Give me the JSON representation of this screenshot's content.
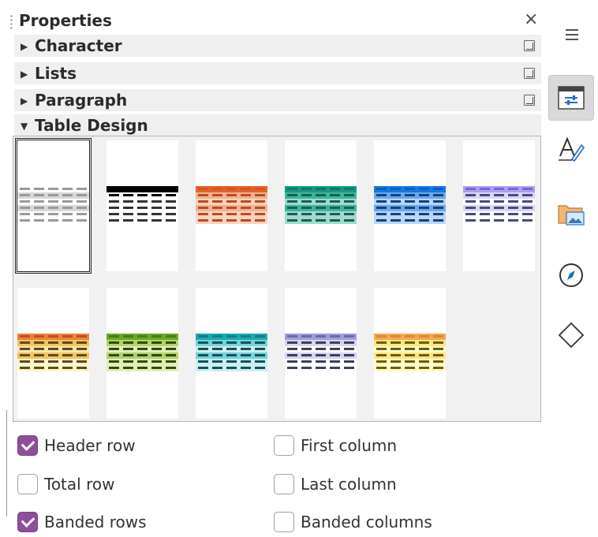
{
  "panel": {
    "title": "Properties",
    "close_glyph": "×"
  },
  "sections": [
    {
      "label": "Character",
      "expanded": false
    },
    {
      "label": "Lists",
      "expanded": false
    },
    {
      "label": "Paragraph",
      "expanded": false
    },
    {
      "label": "Table Design",
      "expanded": true
    }
  ],
  "table_styles": [
    {
      "name": "default",
      "selected": true,
      "colors": [
        "#9a9a9a",
        "#9a9a9a",
        "#9a9a9a",
        "#9a9a9a",
        "#9a9a9a",
        "#9a9a9a"
      ],
      "bg": [
        "#ffffff",
        "#d8d8d8",
        "#ffffff",
        "#d8d8d8",
        "#ffffff",
        "#ffffff"
      ]
    },
    {
      "name": "black",
      "selected": false,
      "colors": [
        "#000000",
        "#000000",
        "#333333",
        "#333333",
        "#333333",
        "#333333"
      ],
      "bg": [
        "#000000",
        "#ffffff",
        "#ffffff",
        "#ffffff",
        "#ffffff",
        "#ffffff"
      ]
    },
    {
      "name": "orange",
      "selected": false,
      "colors": [
        "#d9541e",
        "#b64d24",
        "#b64d24",
        "#b64d24",
        "#b64d24",
        "#b64d24"
      ],
      "bg": [
        "#e8612b",
        "#f6b18f",
        "#fcd3bf",
        "#f6b18f",
        "#fcd3bf",
        "#fcd3bf"
      ]
    },
    {
      "name": "teal",
      "selected": false,
      "colors": [
        "#0f7a66",
        "#1a5e53",
        "#1a5e53",
        "#1a5e53",
        "#1a5e53",
        "#1a5e53"
      ],
      "bg": [
        "#149d85",
        "#3db59c",
        "#9fdacd",
        "#3db59c",
        "#9fdacd",
        "#9fdacd"
      ]
    },
    {
      "name": "blue",
      "selected": false,
      "colors": [
        "#0a5ec2",
        "#1a3f7a",
        "#1a3f7a",
        "#1a3f7a",
        "#1a3f7a",
        "#1a3f7a"
      ],
      "bg": [
        "#137be3",
        "#66a9f0",
        "#b7d7f8",
        "#66a9f0",
        "#b7d7f8",
        "#b7d7f8"
      ]
    },
    {
      "name": "lavender",
      "selected": false,
      "colors": [
        "#7765d8",
        "#4a4880",
        "#4a4880",
        "#4a4880",
        "#4a4880",
        "#4a4880"
      ],
      "bg": [
        "#aba0f0",
        "#d9d4fa",
        "#ffffff",
        "#d9d4fa",
        "#ffffff",
        "#ffffff"
      ]
    },
    {
      "name": "autumn",
      "selected": false,
      "colors": [
        "#c0501e",
        "#5c4a20",
        "#5c4a20",
        "#5c4a20",
        "#5c4a20",
        "#5c4a20"
      ],
      "bg": [
        "#e8833a",
        "#f5c35c",
        "#fae5a8",
        "#f5c35c",
        "#fff6c8",
        "#fff6c8"
      ]
    },
    {
      "name": "green",
      "selected": false,
      "colors": [
        "#4c7a18",
        "#2f4a12",
        "#2f4a12",
        "#2f4a12",
        "#2f4a12",
        "#2f4a12"
      ],
      "bg": [
        "#6aa82a",
        "#b3d36a",
        "#e1efb7",
        "#b3d36a",
        "#e1efb7",
        "#e1efb7"
      ]
    },
    {
      "name": "cyan",
      "selected": false,
      "colors": [
        "#147f86",
        "#1a4f54",
        "#1a4f54",
        "#1a4f54",
        "#1a4f54",
        "#1a4f54"
      ],
      "bg": [
        "#1ba9b3",
        "#72d4da",
        "#c8f0f2",
        "#72d4da",
        "#c8f0f2",
        "#c8f0f2"
      ]
    },
    {
      "name": "slate",
      "selected": false,
      "colors": [
        "#6a6ab0",
        "#3d3d60",
        "#3d3d60",
        "#3d3d60",
        "#3d3d60",
        "#3d3d60"
      ],
      "bg": [
        "#9e9edc",
        "#d5d5f2",
        "#ffffff",
        "#d5d5f2",
        "#ffffff",
        "#ffffff"
      ]
    },
    {
      "name": "yellow",
      "selected": false,
      "colors": [
        "#d98a2a",
        "#6e5a12",
        "#6e5a12",
        "#6e5a12",
        "#6e5a12",
        "#6e5a12"
      ],
      "bg": [
        "#f3a953",
        "#ffe680",
        "#ffffc4",
        "#ffe680",
        "#ffffc4",
        "#ffffc4"
      ]
    }
  ],
  "options": [
    {
      "label": "Header row",
      "checked": true
    },
    {
      "label": "First column",
      "checked": false
    },
    {
      "label": "Total row",
      "checked": false
    },
    {
      "label": "Last column",
      "checked": false
    },
    {
      "label": "Banded rows",
      "checked": true
    },
    {
      "label": "Banded columns",
      "checked": false
    }
  ],
  "sidebar": {
    "items": [
      {
        "name": "properties",
        "icon": "properties-icon",
        "active": true
      },
      {
        "name": "styles",
        "icon": "styles-icon",
        "active": false
      },
      {
        "name": "gallery",
        "icon": "gallery-icon",
        "active": false
      },
      {
        "name": "navigator",
        "icon": "navigator-icon",
        "active": false
      },
      {
        "name": "shapes",
        "icon": "shapes-icon",
        "active": false
      }
    ]
  },
  "colors": {
    "accent_checkbox": "#8c4f9b",
    "section_bg": "#efefef",
    "active_tab_bg": "#d9d9d9"
  }
}
